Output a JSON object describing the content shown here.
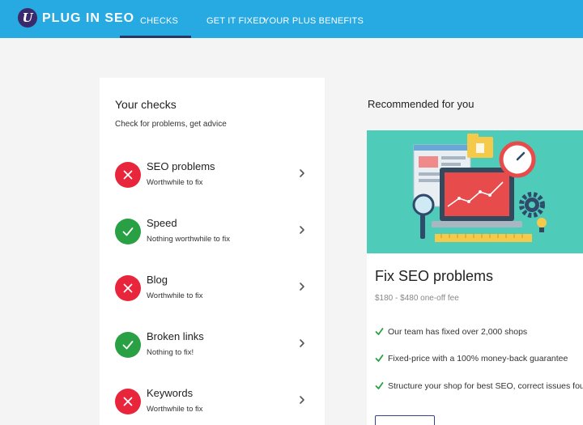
{
  "header": {
    "logo_mark": "U",
    "logo_text": "PLUG IN SEO",
    "nav": [
      {
        "label": "CHECKS"
      },
      {
        "label": "GET IT FIXED"
      },
      {
        "label": "YOUR PLUS BENEFITS"
      }
    ],
    "active_tab": "CHECKS"
  },
  "checks": {
    "title": "Your checks",
    "subtitle": "Check for problems, get advice",
    "items": [
      {
        "title": "SEO problems",
        "status_text": "Worthwhile to fix",
        "status": "bad"
      },
      {
        "title": "Speed",
        "status_text": "Nothing worthwhile to fix",
        "status": "good"
      },
      {
        "title": "Blog",
        "status_text": "Worthwhile to fix",
        "status": "bad"
      },
      {
        "title": "Broken links",
        "status_text": "Nothing to fix!",
        "status": "good"
      },
      {
        "title": "Keywords",
        "status_text": "Worthwhile to fix",
        "status": "bad"
      }
    ]
  },
  "recommended": {
    "label": "Recommended for you",
    "card": {
      "title": "Fix SEO problems",
      "price": "$180 - $480 one-off fee",
      "benefits": [
        "Our team has fixed over 2,000 shops",
        "Fixed-price with a 100% money-back guarantee",
        "Structure your shop for best SEO, correct issues found"
      ]
    }
  },
  "colors": {
    "header_bg": "#27a9e1",
    "status_bad": "#e8253b",
    "status_good": "#2aa044",
    "illustration_bg": "#4fcbb9",
    "tick": "#2aa044"
  }
}
